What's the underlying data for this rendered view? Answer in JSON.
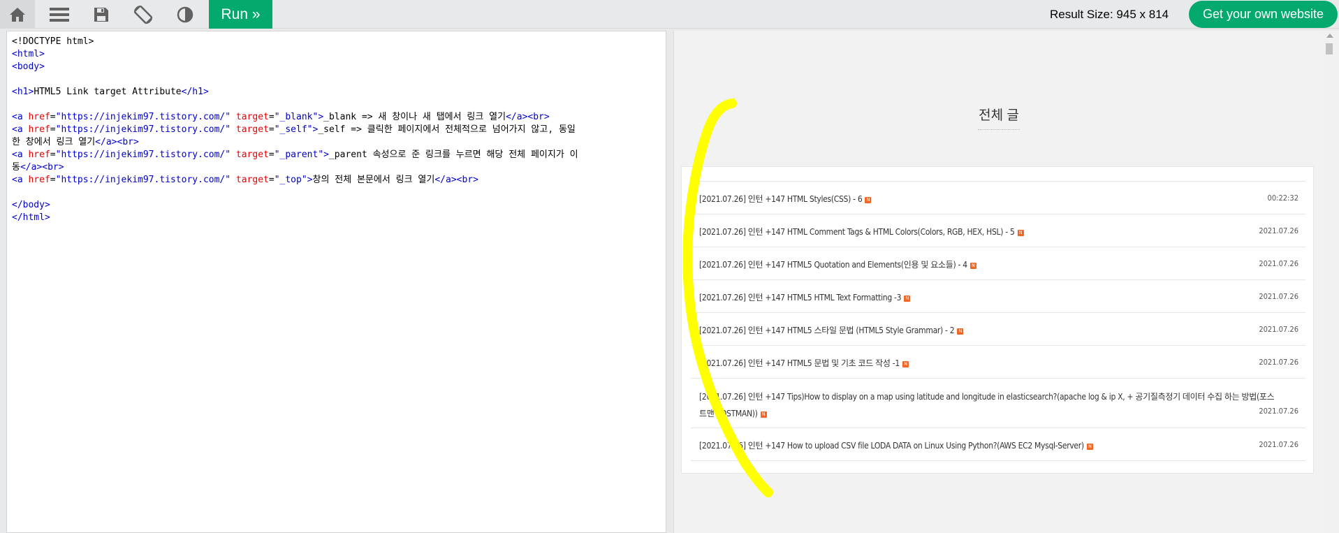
{
  "toolbar": {
    "run_label": "Run »",
    "result_size_label": "Result Size: 945 x 814",
    "get_website_label": "Get your own website"
  },
  "editor": {
    "lines": [
      [
        {
          "c": "t-txt",
          "t": "<!DOCTYPE html>"
        }
      ],
      [
        {
          "c": "t-brack",
          "t": "<"
        },
        {
          "c": "t-tag",
          "t": "html"
        },
        {
          "c": "t-brack",
          "t": ">"
        }
      ],
      [
        {
          "c": "t-brack",
          "t": "<"
        },
        {
          "c": "t-tag",
          "t": "body"
        },
        {
          "c": "t-brack",
          "t": ">"
        }
      ],
      [
        {
          "c": "t-txt",
          "t": ""
        }
      ],
      [
        {
          "c": "t-brack",
          "t": "<"
        },
        {
          "c": "t-tag",
          "t": "h1"
        },
        {
          "c": "t-brack",
          "t": ">"
        },
        {
          "c": "t-txt",
          "t": "HTML5 Link target Attribute"
        },
        {
          "c": "t-brack",
          "t": "</"
        },
        {
          "c": "t-tag",
          "t": "h1"
        },
        {
          "c": "t-brack",
          "t": ">"
        }
      ],
      [
        {
          "c": "t-txt",
          "t": ""
        }
      ],
      [
        {
          "c": "t-brack",
          "t": "<"
        },
        {
          "c": "t-tag",
          "t": "a"
        },
        {
          "c": "t-attr",
          "t": " href"
        },
        {
          "c": "t-txt",
          "t": "="
        },
        {
          "c": "t-val",
          "t": "\"https://injekim97.tistory.com/\""
        },
        {
          "c": "t-attr",
          "t": " target"
        },
        {
          "c": "t-txt",
          "t": "="
        },
        {
          "c": "t-val",
          "t": "\"_blank\""
        },
        {
          "c": "t-brack",
          "t": ">"
        },
        {
          "c": "t-txt",
          "t": "_blank => 새 창이나 새 탭에서 링크 열기"
        },
        {
          "c": "t-brack",
          "t": "</"
        },
        {
          "c": "t-tag",
          "t": "a"
        },
        {
          "c": "t-brack",
          "t": "><"
        },
        {
          "c": "t-tag",
          "t": "br"
        },
        {
          "c": "t-brack",
          "t": ">"
        }
      ],
      [
        {
          "c": "t-brack",
          "t": "<"
        },
        {
          "c": "t-tag",
          "t": "a"
        },
        {
          "c": "t-attr",
          "t": " href"
        },
        {
          "c": "t-txt",
          "t": "="
        },
        {
          "c": "t-val",
          "t": "\"https://injekim97.tistory.com/\""
        },
        {
          "c": "t-attr",
          "t": " target"
        },
        {
          "c": "t-txt",
          "t": "="
        },
        {
          "c": "t-val",
          "t": "\"_self\""
        },
        {
          "c": "t-brack",
          "t": ">"
        },
        {
          "c": "t-txt",
          "t": "_self => 클릭한 페이지에서 전체적으로 넘어가지 않고, 동일"
        }
      ],
      [
        {
          "c": "t-txt",
          "t": "한 창에서 링크 열기"
        },
        {
          "c": "t-brack",
          "t": "</"
        },
        {
          "c": "t-tag",
          "t": "a"
        },
        {
          "c": "t-brack",
          "t": "><"
        },
        {
          "c": "t-tag",
          "t": "br"
        },
        {
          "c": "t-brack",
          "t": ">"
        }
      ],
      [
        {
          "c": "t-brack",
          "t": "<"
        },
        {
          "c": "t-tag",
          "t": "a"
        },
        {
          "c": "t-attr",
          "t": " href"
        },
        {
          "c": "t-txt",
          "t": "="
        },
        {
          "c": "t-val",
          "t": "\"https://injekim97.tistory.com/\""
        },
        {
          "c": "t-attr",
          "t": " target"
        },
        {
          "c": "t-txt",
          "t": "="
        },
        {
          "c": "t-val",
          "t": "\"_parent\""
        },
        {
          "c": "t-brack",
          "t": ">"
        },
        {
          "c": "t-txt",
          "t": "_parent 속성으로 준 링크를 누르면 해당 전체 페이지가 이"
        }
      ],
      [
        {
          "c": "t-txt",
          "t": "동"
        },
        {
          "c": "t-brack",
          "t": "</"
        },
        {
          "c": "t-tag",
          "t": "a"
        },
        {
          "c": "t-brack",
          "t": "><"
        },
        {
          "c": "t-tag",
          "t": "br"
        },
        {
          "c": "t-brack",
          "t": ">"
        }
      ],
      [
        {
          "c": "t-brack",
          "t": "<"
        },
        {
          "c": "t-tag",
          "t": "a"
        },
        {
          "c": "t-attr",
          "t": " href"
        },
        {
          "c": "t-txt",
          "t": "="
        },
        {
          "c": "t-val",
          "t": "\"https://injekim97.tistory.com/\""
        },
        {
          "c": "t-attr",
          "t": " target"
        },
        {
          "c": "t-txt",
          "t": "="
        },
        {
          "c": "t-val",
          "t": "\"_top\""
        },
        {
          "c": "t-brack",
          "t": ">"
        },
        {
          "c": "t-txt",
          "t": "창의 전체 본문에서 링크 열기"
        },
        {
          "c": "t-brack",
          "t": "</"
        },
        {
          "c": "t-tag",
          "t": "a"
        },
        {
          "c": "t-brack",
          "t": "><"
        },
        {
          "c": "t-tag",
          "t": "br"
        },
        {
          "c": "t-brack",
          "t": ">"
        }
      ],
      [
        {
          "c": "t-txt",
          "t": ""
        }
      ],
      [
        {
          "c": "t-brack",
          "t": "</"
        },
        {
          "c": "t-tag",
          "t": "body"
        },
        {
          "c": "t-brack",
          "t": ">"
        }
      ],
      [
        {
          "c": "t-brack",
          "t": "</"
        },
        {
          "c": "t-tag",
          "t": "html"
        },
        {
          "c": "t-brack",
          "t": ">"
        }
      ]
    ]
  },
  "result": {
    "section_title": "전체 글",
    "posts": [
      {
        "title": "[2021.07.26] 인턴 +147 HTML Styles(CSS) - 6",
        "badge": "N",
        "date": "00:22:32"
      },
      {
        "title": "[2021.07.26] 인턴 +147 HTML Comment Tags & HTML Colors(Colors, RGB, HEX, HSL) - 5",
        "badge": "N",
        "date": "2021.07.26"
      },
      {
        "title": "[2021.07.26] 인턴 +147 HTML5 Quotation and Elements(인용 및 요소들) - 4",
        "badge": "N",
        "date": "2021.07.26"
      },
      {
        "title": "[2021.07.26] 인턴 +147 HTML5 HTML Text Formatting -3",
        "badge": "N",
        "date": "2021.07.26"
      },
      {
        "title": "[2021.07.26] 인턴 +147 HTML5 스타일 문법 (HTML5 Style Grammar) - 2",
        "badge": "N",
        "date": "2021.07.26"
      },
      {
        "title": "[2021.07.26] 인턴 +147 HTML5 문법 및 기초 코드 작성 -1",
        "badge": "N",
        "date": "2021.07.26"
      },
      {
        "title": "[2021.07.26] 인턴 +147 Tips)How to display on a map using latitude and longitude in elasticsearch?(apache log & ip X, + 공기질측정기 데이터 수집 하는 방법(포스",
        "title2": "트맨 POSTMAN))",
        "badge": "N",
        "date": "2021.07.26"
      },
      {
        "title": "[2021.07.26] 인턴 +147 How to upload CSV file LODA DATA on Linux Using Python?(AWS EC2 Mysql-Server)",
        "badge": "N",
        "date": "2021.07.26"
      }
    ]
  },
  "colors": {
    "accent": "#04aa6d",
    "highlighter": "#ffff00",
    "badge": "#f26522"
  }
}
